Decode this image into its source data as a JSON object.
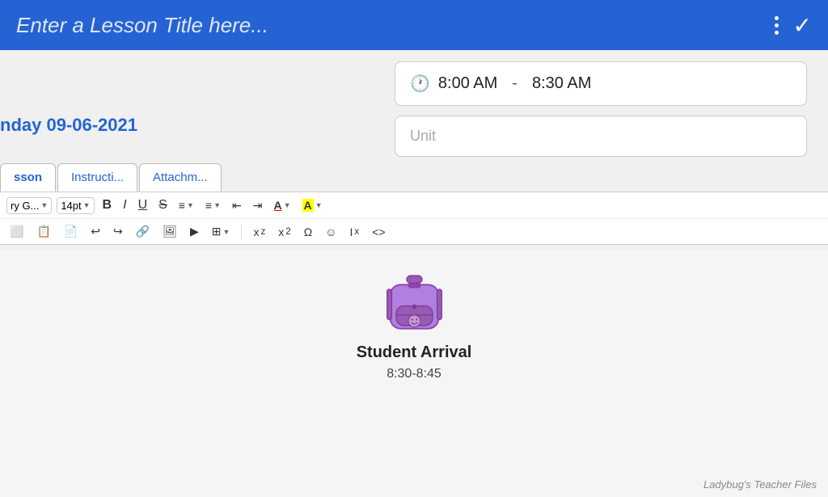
{
  "header": {
    "title": "Enter a Lesson Title here...",
    "dots_label": "more options",
    "check_label": "confirm"
  },
  "time_range": {
    "start": "8:00 AM",
    "dash": "-",
    "end": "8:30 AM"
  },
  "unit_placeholder": "Unit",
  "date": {
    "label": "nday 09-06-2021"
  },
  "tabs": [
    {
      "label": "sson",
      "active": true
    },
    {
      "label": "Instructi...",
      "active": false
    },
    {
      "label": "Attachm...",
      "active": false
    }
  ],
  "toolbar": {
    "font_family": "ry G...",
    "font_size": "14pt",
    "bold": "B",
    "italic": "I",
    "underline": "U",
    "strikethrough": "S",
    "unordered_list": "≡",
    "ordered_list": "≡",
    "indent_decrease": "⇤",
    "indent_increase": "⇥",
    "font_color": "A",
    "highlight": "A",
    "undo": "↩",
    "redo": "↪",
    "link": "🔗",
    "image": "🖼",
    "video": "▶",
    "table": "⊞",
    "subscript": "x₂",
    "superscript": "x²",
    "omega": "Ω",
    "emoji": "☺",
    "clear_format": "Ix",
    "source": "<>"
  },
  "content": {
    "backpack_emoji": "🎒",
    "student_arrival_label": "Student Arrival",
    "student_arrival_time": "8:30-8:45"
  },
  "watermark": "Ladybug's Teacher Files"
}
